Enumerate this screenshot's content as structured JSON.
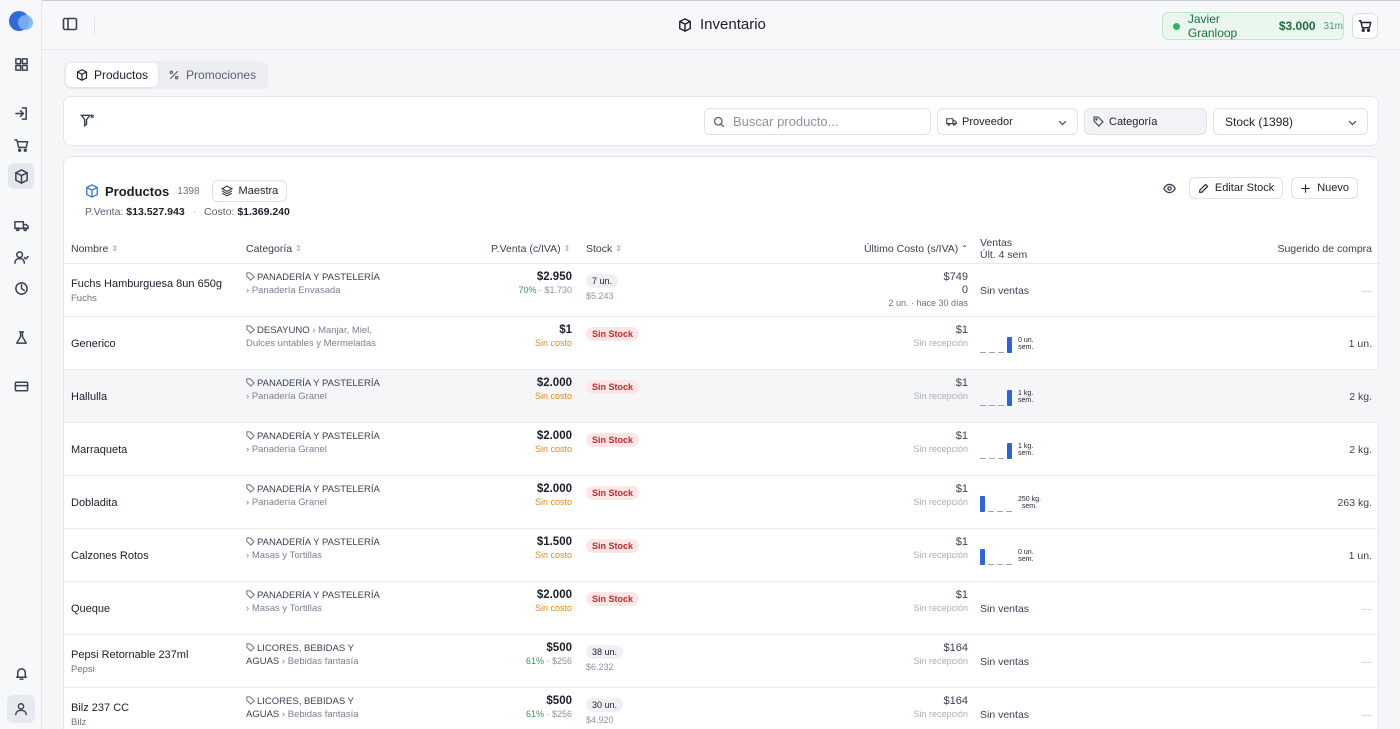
{
  "app": {
    "title": "Inventario"
  },
  "user": {
    "name": "Javier Granloop",
    "amount": "$3.000",
    "time": "31m"
  },
  "tabs": [
    {
      "label": "Productos"
    },
    {
      "label": "Promociones"
    }
  ],
  "filters": {
    "search_placeholder": "Buscar producto...",
    "proveedor": "Proveedor",
    "categoria": "Categoría",
    "stock": "Stock (1398)"
  },
  "panel": {
    "title": "Productos",
    "count": "1398",
    "chip": "Maestra",
    "pventa_label": "P.Venta:",
    "pventa_value": "$13.527.943",
    "costo_label": "Costo:",
    "costo_value": "$1.369.240",
    "edit_stock": "Editar Stock",
    "new": "Nuevo"
  },
  "columns": {
    "nombre": "Nombre",
    "categoria": "Categoría",
    "pventa": "P.Venta (c/IVA)",
    "stock": "Stock",
    "ultimo_costo": "Último Costo (s/IVA)",
    "ventas": "Ventas",
    "ventas_sub": "Últ. 4 sem",
    "sugerido": "Sugerido de compra"
  },
  "rows": [
    {
      "name": "Fuchs Hamburguesa 8un 650g",
      "brand": "Fuchs",
      "cat_root": "PANADERÍA Y PASTELERÍA",
      "cat_sub": "Panadería Envasada",
      "price": "$2.950",
      "margin_pct": "70%",
      "margin_rest": " · $1.730",
      "price_sub": "",
      "stock": "7 un.",
      "stock_sub": "$5.243",
      "stock_red": false,
      "cost": "$749",
      "cost_2": "0",
      "cost_sub": "2 un. · hace 30 días",
      "sales_text": "Sin ventas",
      "spark": [],
      "spark_label_1": "",
      "spark_label_2": "",
      "suggest": "—"
    },
    {
      "name": "Generico",
      "brand": "",
      "cat_root": "DESAYUNO",
      "cat_sub": "Manjar, Miel, Dulces untables y Mermeladas",
      "price": "$1",
      "margin_pct": "",
      "margin_rest": "",
      "price_sub": "Sin costo",
      "stock": "Sin Stock",
      "stock_sub": "",
      "stock_red": true,
      "cost": "$1",
      "cost_2": "",
      "cost_sub": "Sin recepción",
      "sales_text": "",
      "spark": [
        0,
        0,
        0,
        1
      ],
      "spark_label_1": "0 un.",
      "spark_label_2": "sem.",
      "suggest": "1 un."
    },
    {
      "name": "Hallulla",
      "brand": "",
      "cat_root": "PANADERÍA Y PASTELERÍA",
      "cat_sub": "Panadería Granel",
      "price": "$2.000",
      "margin_pct": "",
      "margin_rest": "",
      "price_sub": "Sin costo",
      "stock": "Sin Stock",
      "stock_sub": "",
      "stock_red": true,
      "cost": "$1",
      "cost_2": "",
      "cost_sub": "Sin recepción",
      "sales_text": "",
      "spark": [
        0,
        0,
        0,
        1
      ],
      "spark_label_1": "1 kg.",
      "spark_label_2": "sem.",
      "suggest": "2 kg."
    },
    {
      "name": "Marraqueta",
      "brand": "",
      "cat_root": "PANADERÍA Y PASTELERÍA",
      "cat_sub": "Panadería Granel",
      "price": "$2.000",
      "margin_pct": "",
      "margin_rest": "",
      "price_sub": "Sin costo",
      "stock": "Sin Stock",
      "stock_sub": "",
      "stock_red": true,
      "cost": "$1",
      "cost_2": "",
      "cost_sub": "Sin recepción",
      "sales_text": "",
      "spark": [
        0,
        0,
        0,
        1
      ],
      "spark_label_1": "1 kg.",
      "spark_label_2": "sem.",
      "suggest": "2 kg."
    },
    {
      "name": "Dobladita",
      "brand": "",
      "cat_root": "PANADERÍA Y PASTELERÍA",
      "cat_sub": "Panadería Granel",
      "price": "$2.000",
      "margin_pct": "",
      "margin_rest": "",
      "price_sub": "Sin costo",
      "stock": "Sin Stock",
      "stock_sub": "",
      "stock_red": true,
      "cost": "$1",
      "cost_2": "",
      "cost_sub": "Sin recepción",
      "sales_text": "",
      "spark": [
        1,
        0,
        0,
        0
      ],
      "spark_label_1": "250 kg.",
      "spark_label_2": "sem.",
      "suggest": "263 kg."
    },
    {
      "name": "Calzones Rotos",
      "brand": "",
      "cat_root": "PANADERÍA Y PASTELERÍA",
      "cat_sub": "Masas y Tortillas",
      "price": "$1.500",
      "margin_pct": "",
      "margin_rest": "",
      "price_sub": "Sin costo",
      "stock": "Sin Stock",
      "stock_sub": "",
      "stock_red": true,
      "cost": "$1",
      "cost_2": "",
      "cost_sub": "Sin recepción",
      "sales_text": "",
      "spark": [
        1,
        0,
        0,
        0
      ],
      "spark_label_1": "0 un.",
      "spark_label_2": "sem.",
      "suggest": "1 un."
    },
    {
      "name": "Queque",
      "brand": "",
      "cat_root": "PANADERÍA Y PASTELERÍA",
      "cat_sub": "Masas y Tortillas",
      "price": "$2.000",
      "margin_pct": "",
      "margin_rest": "",
      "price_sub": "Sin costo",
      "stock": "Sin Stock",
      "stock_sub": "",
      "stock_red": true,
      "cost": "$1",
      "cost_2": "",
      "cost_sub": "Sin recepción",
      "sales_text": "Sin ventas",
      "spark": [],
      "spark_label_1": "",
      "spark_label_2": "",
      "suggest": "—"
    },
    {
      "name": "Pepsi Retornable 237ml",
      "brand": "Pepsi",
      "cat_root": "LICORES, BEBIDAS Y AGUAS",
      "cat_sub": "Bebidas fantasía",
      "price": "$500",
      "margin_pct": "61%",
      "margin_rest": " · $256",
      "price_sub": "",
      "stock": "38 un.",
      "stock_sub": "$6.232",
      "stock_red": false,
      "cost": "$164",
      "cost_2": "",
      "cost_sub": "Sin recepción",
      "sales_text": "Sin ventas",
      "spark": [],
      "spark_label_1": "",
      "spark_label_2": "",
      "suggest": "—"
    },
    {
      "name": "Bilz 237 CC",
      "brand": "Bilz",
      "cat_root": "LICORES, BEBIDAS Y AGUAS",
      "cat_sub": "Bebidas fantasía",
      "price": "$500",
      "margin_pct": "61%",
      "margin_rest": " · $256",
      "price_sub": "",
      "stock": "30 un.",
      "stock_sub": "$4.920",
      "stock_red": false,
      "cost": "$164",
      "cost_2": "",
      "cost_sub": "Sin recepción",
      "sales_text": "Sin ventas",
      "spark": [],
      "spark_label_1": "",
      "spark_label_2": "",
      "suggest": "—"
    }
  ],
  "icons": {
    "sidebar": [
      "grid-icon",
      "login-icon",
      "cart-icon",
      "box-icon",
      "truck-icon",
      "user-check-icon",
      "clock-icon",
      "flask-icon",
      "card-icon",
      "bell-icon",
      "user-icon"
    ]
  },
  "colors": {
    "accent": "#2f62e0",
    "success": "#2bb36a",
    "danger": "#c22b2b",
    "warning": "#e38a17"
  }
}
